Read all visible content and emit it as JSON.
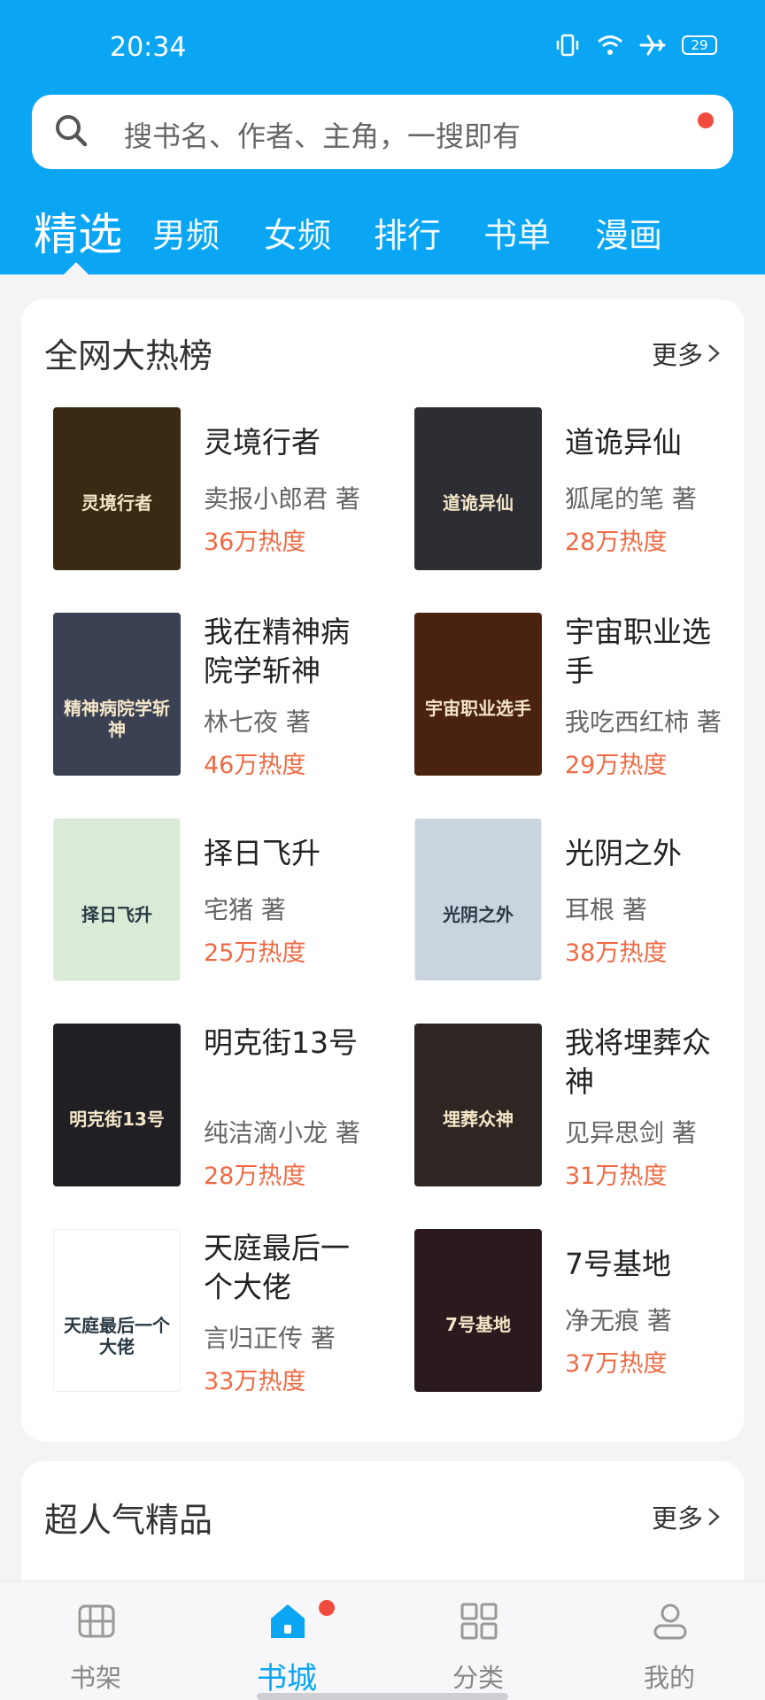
{
  "status": {
    "time": "20:34",
    "battery": "29"
  },
  "search": {
    "placeholder": "搜书名、作者、主角，一搜即有"
  },
  "tabs": [
    "精选",
    "男频",
    "女频",
    "排行",
    "书单",
    "漫画"
  ],
  "section1": {
    "title": "全网大热榜",
    "more": "更多",
    "books": [
      {
        "title": "灵境行者",
        "author": "卖报小郎君 著",
        "heat": "36万热度",
        "cover_color": "#3a2a14",
        "cover_text": "灵境行者"
      },
      {
        "title": "道诡异仙",
        "author": "狐尾的笔 著",
        "heat": "28万热度",
        "cover_color": "#2c2e33",
        "cover_text": "道诡异仙"
      },
      {
        "title": "我在精神病院学斩神",
        "author": "林七夜 著",
        "heat": "46万热度",
        "cover_color": "#3a4152",
        "cover_text": "精神病院学斩神"
      },
      {
        "title": "宇宙职业选手",
        "author": "我吃西红柿 著",
        "heat": "29万热度",
        "cover_color": "#4a2210",
        "cover_text": "宇宙职业选手"
      },
      {
        "title": "择日飞升",
        "author": "宅猪 著",
        "heat": "25万热度",
        "cover_color": "#d9ead7",
        "cover_text": "择日飞升"
      },
      {
        "title": "光阴之外",
        "author": "耳根 著",
        "heat": "38万热度",
        "cover_color": "#c9d4df",
        "cover_text": "光阴之外"
      },
      {
        "title": "明克街13号",
        "author": "纯洁滴小龙 著",
        "heat": "28万热度",
        "cover_color": "#1f1f24",
        "cover_text": "明克街13号"
      },
      {
        "title": "我将埋葬众神",
        "author": "见异思剑 著",
        "heat": "31万热度",
        "cover_color": "#2d2622",
        "cover_text": "埋葬众神"
      },
      {
        "title": "天庭最后一个大佬",
        "author": "言归正传 著",
        "heat": "33万热度",
        "cover_color": "#ffffff",
        "cover_text": "天庭最后一个大佬"
      },
      {
        "title": "7号基地",
        "author": "净无痕 著",
        "heat": "37万热度",
        "cover_color": "#2a1a1e",
        "cover_text": "7号基地"
      }
    ]
  },
  "section2": {
    "title": "超人气精品",
    "more": "更多"
  },
  "nav": {
    "items": [
      {
        "label": "书架",
        "icon": "bookshelf-icon"
      },
      {
        "label": "书城",
        "icon": "home-icon"
      },
      {
        "label": "分类",
        "icon": "category-icon"
      },
      {
        "label": "我的",
        "icon": "profile-icon"
      }
    ]
  },
  "colors": {
    "accent": "#0aa6f4",
    "heat": "#ef6a43",
    "badge": "#f04b3c"
  }
}
